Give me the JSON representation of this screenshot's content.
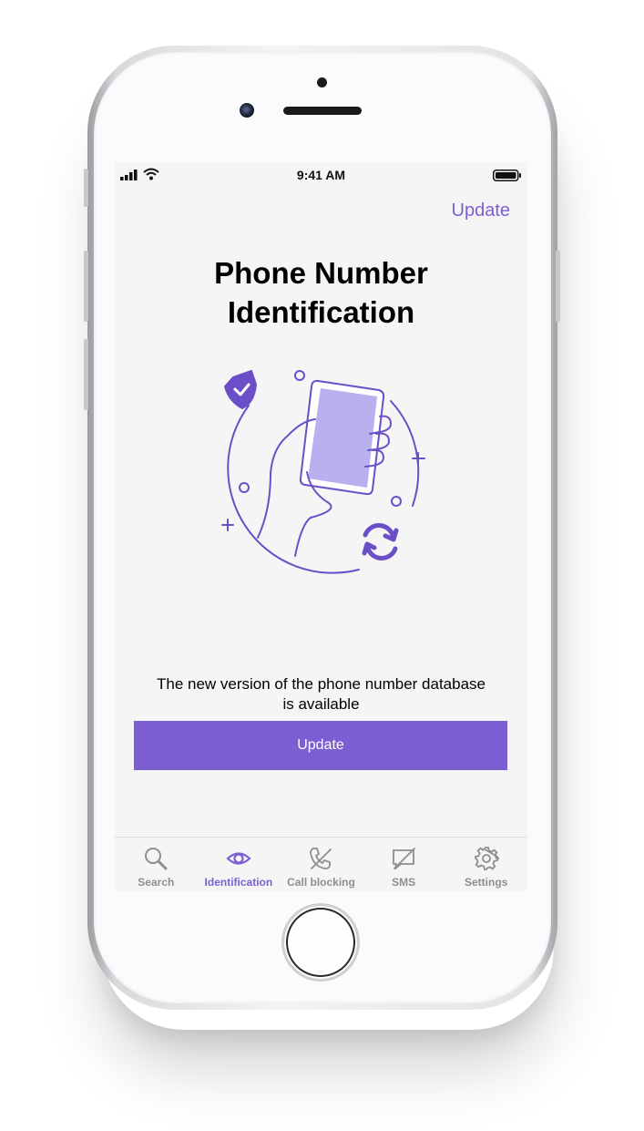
{
  "status_bar": {
    "time": "9:41 AM"
  },
  "header": {
    "update_link": "Update"
  },
  "main": {
    "title_line1": "Phone Number",
    "title_line2": "Identification",
    "message_line1": "The new version of the phone number database",
    "message_line2": "is available",
    "update_button": "Update"
  },
  "tabs": [
    {
      "label": "Search",
      "icon": "search-icon",
      "active": false
    },
    {
      "label": "Identification",
      "icon": "eye-icon",
      "active": true
    },
    {
      "label": "Call blocking",
      "icon": "call-blocked-icon",
      "active": false
    },
    {
      "label": "SMS",
      "icon": "sms-blocked-icon",
      "active": false
    },
    {
      "label": "Settings",
      "icon": "gear-icon",
      "active": false
    }
  ],
  "colors": {
    "accent": "#7b5fd2",
    "inactive": "#8e8e8e",
    "background": "#f5f5f5"
  }
}
